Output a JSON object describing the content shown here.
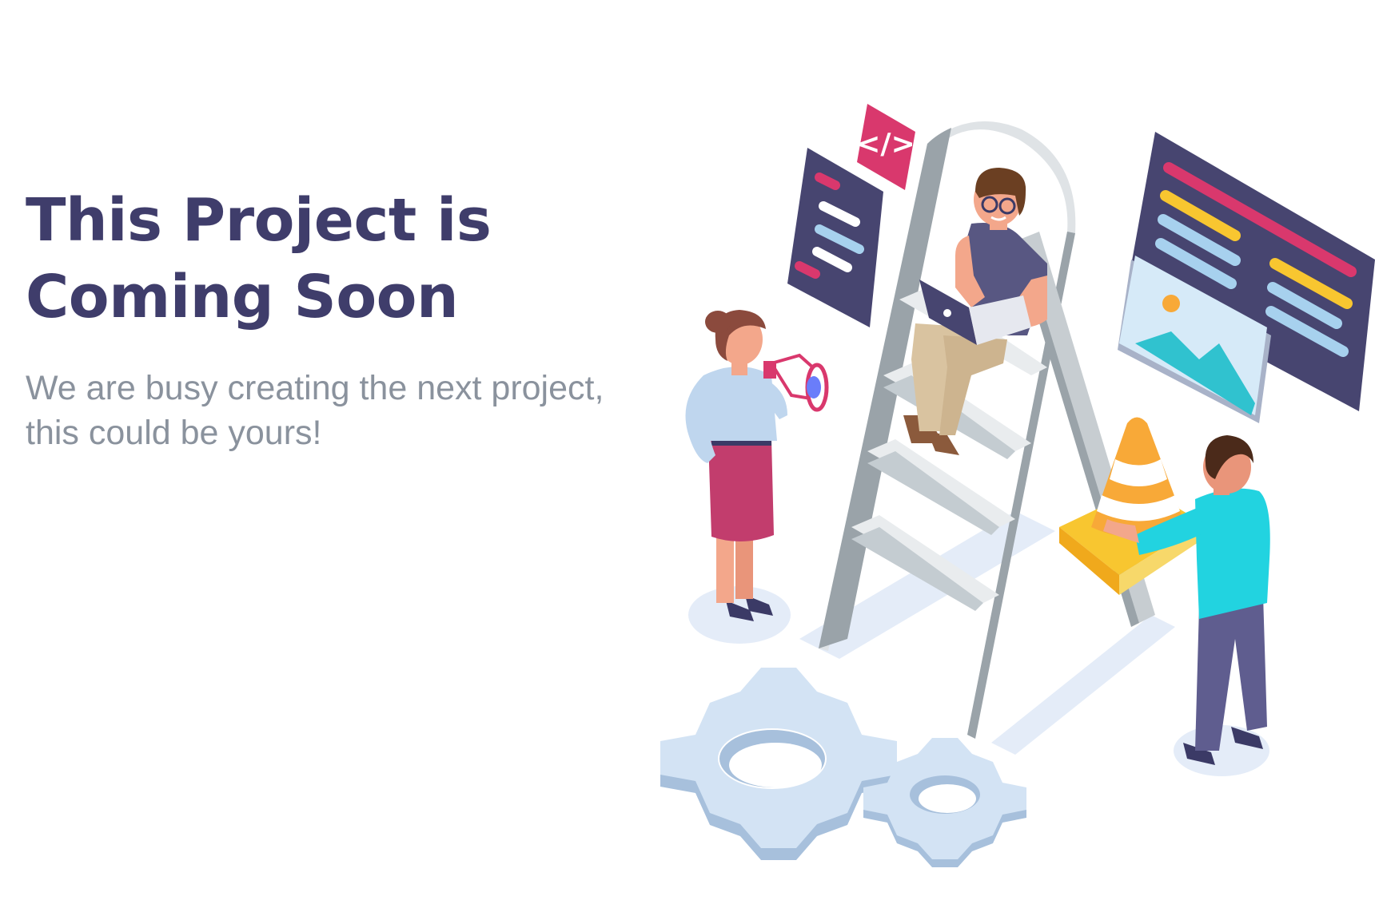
{
  "hero": {
    "title_line1": "This Project is",
    "title_line2": "Coming Soon",
    "subtitle_line1": "We are busy creating the next project,",
    "subtitle_line2": "this could be yours!"
  },
  "colors": {
    "heading": "#3f3d6b",
    "subtitle": "#8a929d",
    "accent_pink": "#d9386d",
    "panel_dark": "#474570",
    "accent_cyan": "#22d3e0",
    "accent_yellow": "#f8c630",
    "gear_blue": "#c9dcef"
  },
  "illustration": {
    "code_badge_text": "</>",
    "icons": [
      "code-icon",
      "megaphone-icon",
      "laptop-icon",
      "image-icon",
      "traffic-cone-icon",
      "gear-icon"
    ]
  }
}
